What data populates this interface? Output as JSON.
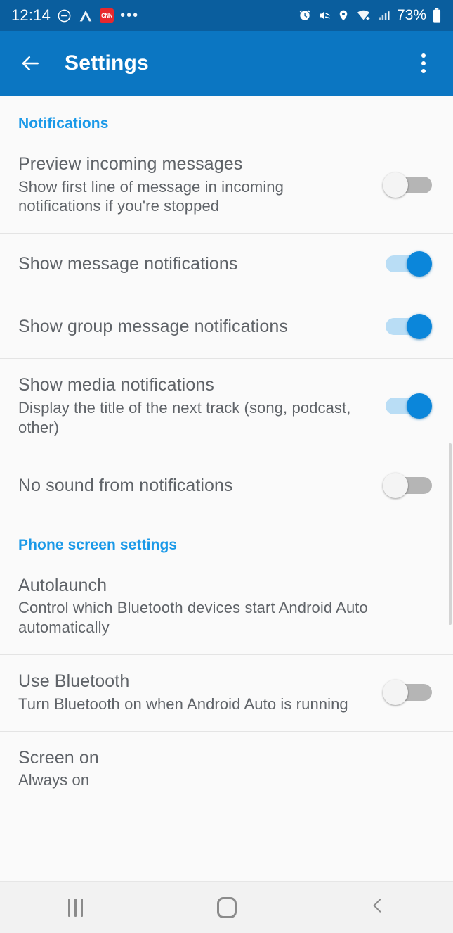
{
  "status_bar": {
    "time": "12:14",
    "battery_percent": "73%",
    "left_icons": [
      "do-not-disturb-icon",
      "android-auto-icon",
      "cnn-app-icon",
      "more-notifications-icon"
    ],
    "app_badge_label": "CNN",
    "right_icons": [
      "alarm-icon",
      "volume-muted-icon",
      "location-icon",
      "wifi-icon",
      "cellular-signal-icon",
      "battery-icon"
    ],
    "background_color": "#0a5e9e"
  },
  "app_bar": {
    "title": "Settings",
    "back_label": "Back",
    "overflow_label": "More options",
    "background_color": "#0b76c2"
  },
  "sections": [
    {
      "header": "Notifications",
      "header_color": "#1a99e8",
      "rows": [
        {
          "title": "Preview incoming messages",
          "subtitle": "Show first line of message in incoming notifications if you're stopped",
          "toggle": "off"
        },
        {
          "title": "Show message notifications",
          "subtitle": "",
          "toggle": "on"
        },
        {
          "title": "Show group message notifications",
          "subtitle": "",
          "toggle": "on"
        },
        {
          "title": "Show media notifications",
          "subtitle": "Display the title of the next track (song, podcast, other)",
          "toggle": "on"
        },
        {
          "title": "No sound from notifications",
          "subtitle": "",
          "toggle": "off"
        }
      ]
    },
    {
      "header": "Phone screen settings",
      "header_color": "#1a99e8",
      "rows": [
        {
          "title": "Autolaunch",
          "subtitle": "Control which Bluetooth devices start Android Auto automatically",
          "toggle": "none"
        },
        {
          "title": "Use Bluetooth",
          "subtitle": "Turn Bluetooth on when Android Auto is running",
          "toggle": "off"
        },
        {
          "title": "Screen on",
          "subtitle": "Always on",
          "toggle": "none"
        }
      ]
    }
  ],
  "nav_bar": {
    "recents_label": "Recents",
    "home_label": "Home",
    "back_label": "Back"
  }
}
